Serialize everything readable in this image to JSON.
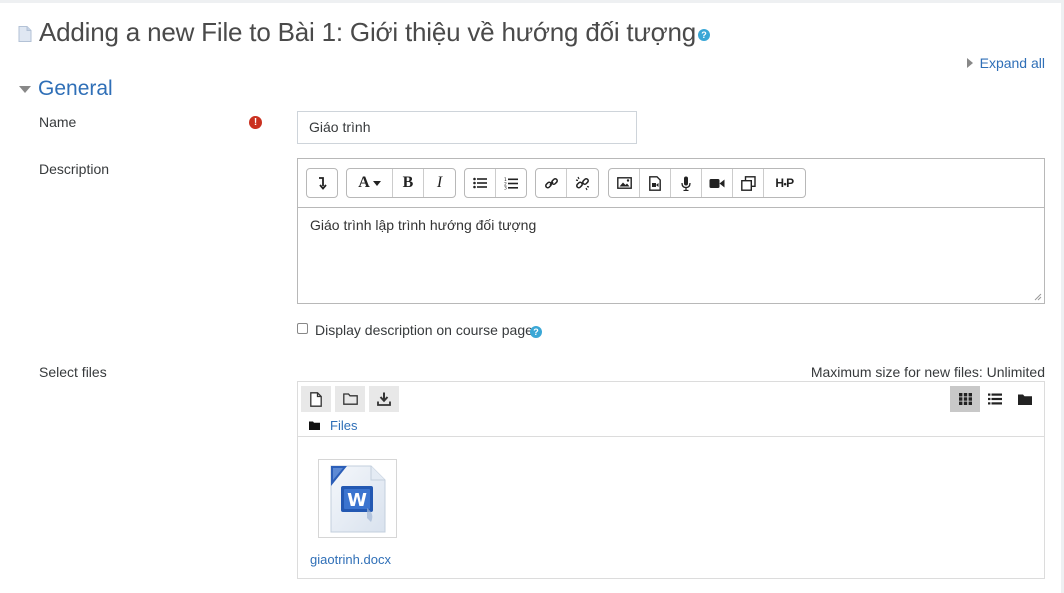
{
  "page": {
    "title": "Adding a new File to Bài 1: Giới thiệu về hướng đối tượng",
    "help_icon": "question-circle-icon"
  },
  "expand_all": "Expand all",
  "section": {
    "title": "General"
  },
  "form": {
    "name_label": "Name",
    "name_value": "Giáo trình",
    "description_label": "Description",
    "description_value": "Giáo trình lập trình hướng đối tượng",
    "toolbar_groups": [
      [
        "toolbar-toggle-icon"
      ],
      [
        "font-style-icon",
        "bold-icon",
        "italic-icon"
      ],
      [
        "unordered-list-icon",
        "ordered-list-icon"
      ],
      [
        "link-icon",
        "unlink-icon"
      ],
      [
        "image-icon",
        "media-icon",
        "record-audio-icon",
        "record-video-icon",
        "manage-files-icon",
        "h5p-icon"
      ]
    ],
    "display_description_label": "Display description on course page",
    "select_files_label": "Select files",
    "max_size_text": "Maximum size for new files: Unlimited"
  },
  "filepicker": {
    "path_label": "Files",
    "files": [
      {
        "name": "giaotrinh.docx",
        "icon": "word-document-icon"
      }
    ]
  },
  "colors": {
    "link": "#2f6fb7",
    "required": "#ca3120",
    "help": "#3aa7d6"
  }
}
